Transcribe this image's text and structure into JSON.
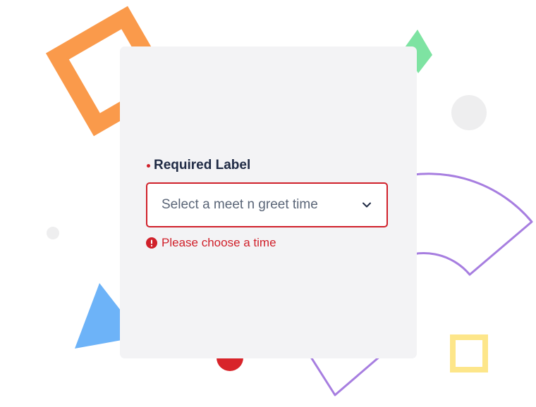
{
  "form": {
    "label": "Required Label",
    "select_placeholder": "Select a meet n greet time",
    "error_message": "Please choose a time"
  },
  "colors": {
    "error": "#d0202a",
    "label": "#1f2a44",
    "card_background": "#f3f3f5",
    "shape_orange": "#fa9a4b",
    "shape_green": "#7ee3a2",
    "shape_purple": "#a77ee0",
    "shape_blue": "#6db3f8",
    "shape_yellow": "#fde68a",
    "shape_red": "#d8242a",
    "shape_gray": "#eeeeef"
  },
  "icons": {
    "select_chevron": "chevron-down-icon",
    "error": "exclamation-circle-icon",
    "required": "required-dot-icon"
  }
}
